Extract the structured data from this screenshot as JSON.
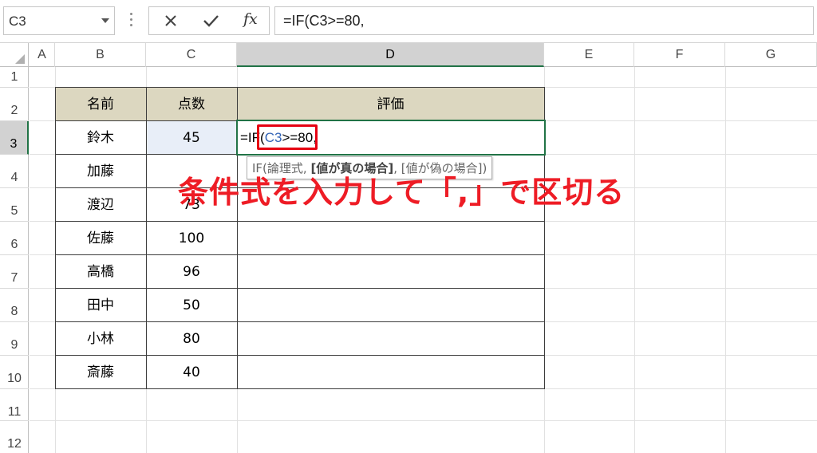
{
  "name_box": {
    "value": "C3"
  },
  "formula_bar": {
    "fx_label": "fx",
    "formula": "=IF(C3>=80,"
  },
  "columns": [
    "A",
    "B",
    "C",
    "D",
    "E",
    "F",
    "G"
  ],
  "rows": [
    "1",
    "2",
    "3",
    "4",
    "5",
    "6",
    "7",
    "8",
    "9",
    "10",
    "11",
    "12"
  ],
  "table": {
    "headers": [
      "名前",
      "点数",
      "評価"
    ],
    "records": [
      {
        "name": "鈴木",
        "score": "45"
      },
      {
        "name": "加藤",
        "score": ""
      },
      {
        "name": "渡辺",
        "score": "73"
      },
      {
        "name": "佐藤",
        "score": "100"
      },
      {
        "name": "高橋",
        "score": "96"
      },
      {
        "name": "田中",
        "score": "50"
      },
      {
        "name": "小林",
        "score": "80"
      },
      {
        "name": "斎藤",
        "score": "40"
      }
    ]
  },
  "editing_cell": {
    "prefix": "=IF(",
    "ref": "C3",
    "suffix": ">=80,"
  },
  "tooltip": {
    "fn": "IF(",
    "arg1": "論理式",
    "sep1": ", ",
    "arg2": "[値が真の場合]",
    "sep2": ", ",
    "arg3": "[値が偽の場合])"
  },
  "annotation": {
    "text": "条件式を入力して「,」で区切る"
  },
  "colors": {
    "accent_green": "#217346",
    "header_fill": "#dcd7c0",
    "highlight_red": "#e60012",
    "ref_blue": "#3566b8"
  }
}
